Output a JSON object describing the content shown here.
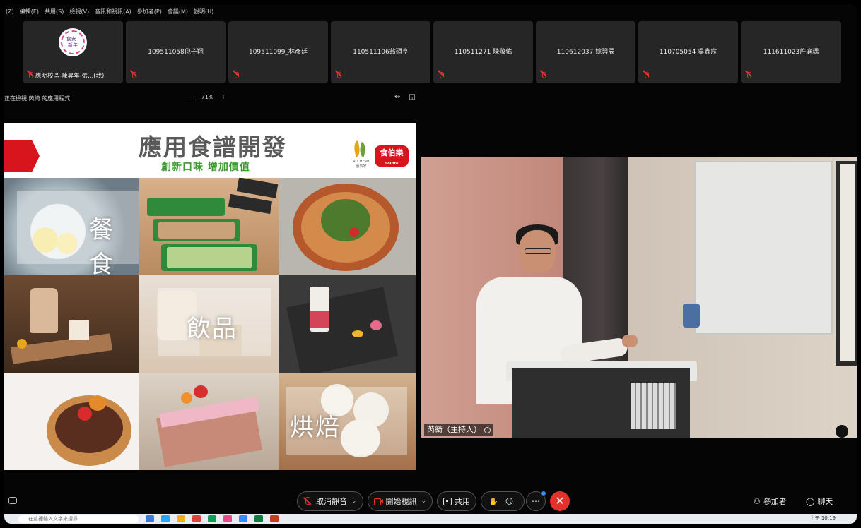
{
  "menu": [
    "(Z)",
    "編輯(E)",
    "共用(S)",
    "檢視(V)",
    "音訊和視訊(A)",
    "參加者(P)",
    "會議(M)",
    "說明(H)"
  ],
  "participants": [
    {
      "name": "",
      "host_label": "應明校區-陳昇年-張...(我)",
      "avatar_text": "食安..\n新年"
    },
    {
      "name": "109511058倪子翔"
    },
    {
      "name": "109511099_林彥廷"
    },
    {
      "name": "110511106翁碩亨"
    },
    {
      "name": "110511271 陳敬佑"
    },
    {
      "name": "110612037 姚羿辰"
    },
    {
      "name": "110705054 吳鑫宸"
    },
    {
      "name": "111611023許庭瑀"
    }
  ],
  "share": {
    "viewing": "正在檢視 芮綺 的應用程式",
    "zoom_minus": "−",
    "zoom_level": "71%",
    "zoom_plus": "+",
    "ctl1": "↔",
    "ctl2": "◱"
  },
  "slide": {
    "title": "應用食譜開發",
    "subtitle": "創新口味 增加價值",
    "logo_a": "ALCHEMY\n食頂家",
    "logo_b": "食伯樂",
    "logo_b_small": "Soutte",
    "labels": [
      "餐食",
      "飲品",
      "烘焙"
    ]
  },
  "video": {
    "name_tag": "芮綺（主持人）"
  },
  "toolbar": {
    "unmute": "取消靜音",
    "start_video": "開始視訊",
    "share": "共用",
    "participants": "參加者",
    "chat": "聊天"
  },
  "taskbar": {
    "search_placeholder": "在這裡輸入文字來搜尋",
    "clock": "上午 10:19"
  },
  "colors": {
    "accent_red": "#d8141c",
    "green": "#3b9b2f",
    "leave_red": "#e8302a"
  }
}
